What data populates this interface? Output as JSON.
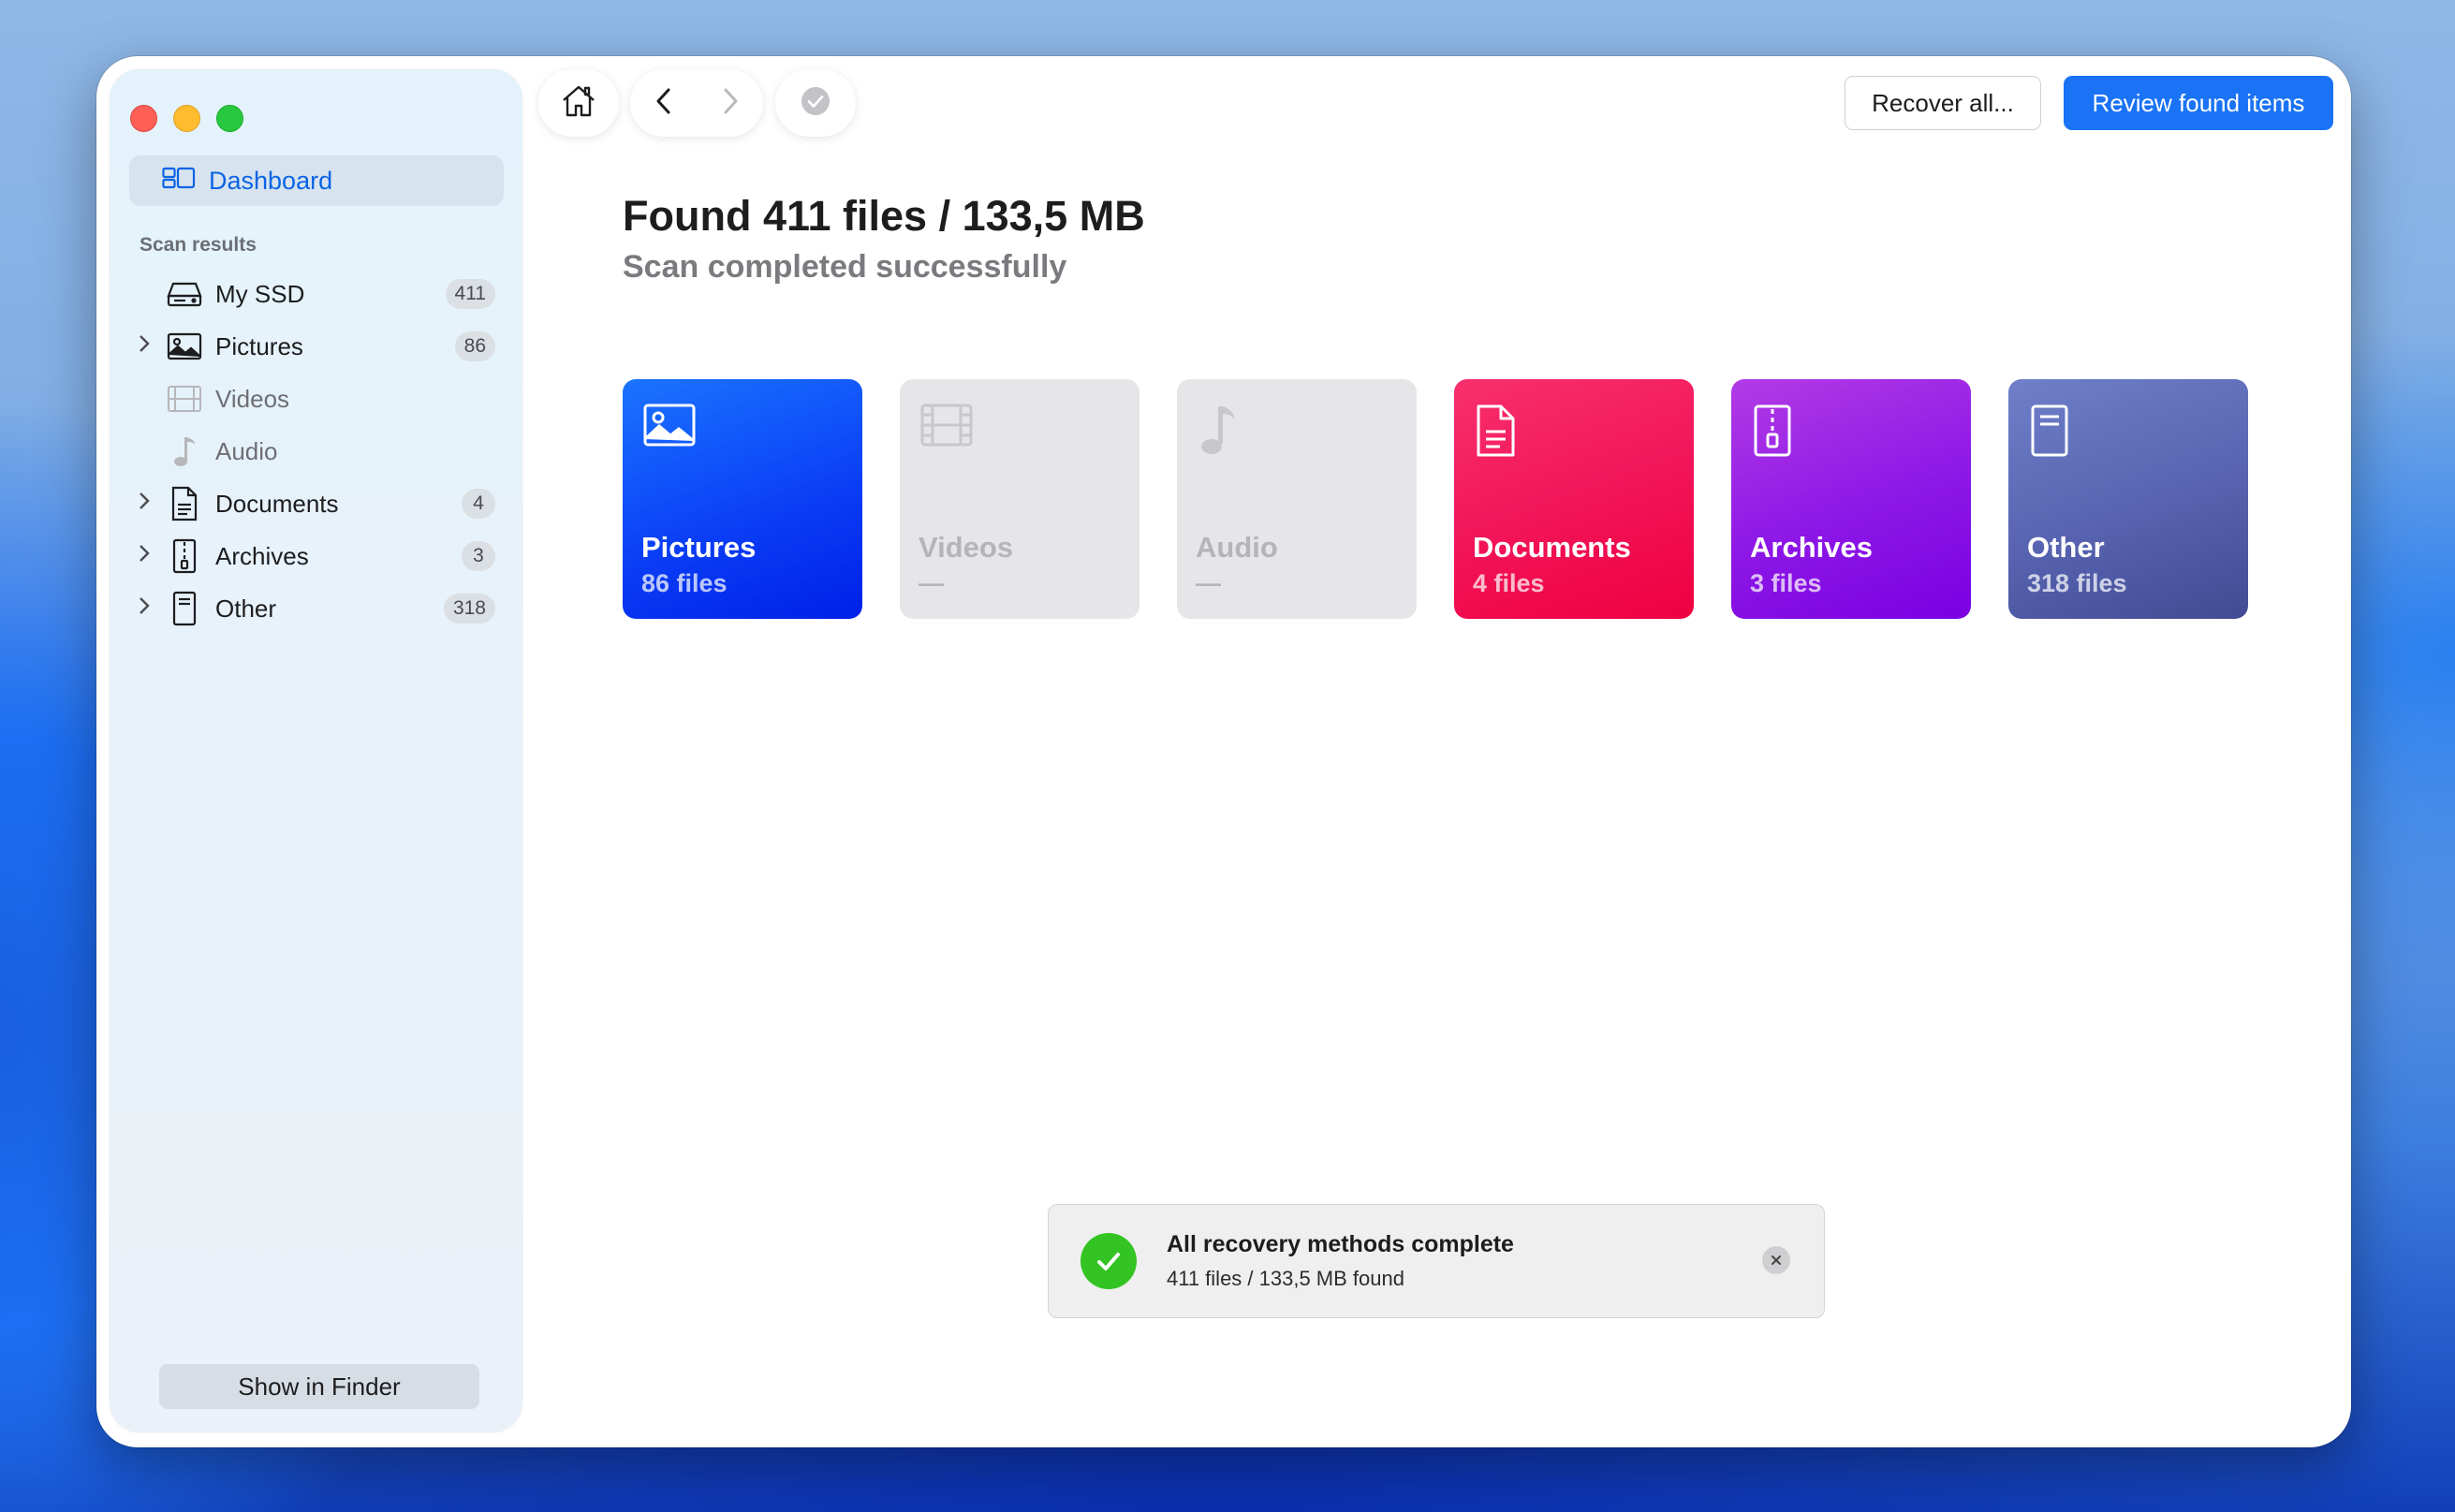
{
  "sidebar": {
    "dashboard_label": "Dashboard",
    "section_title": "Scan results",
    "items": [
      {
        "label": "My SSD",
        "count": "411"
      },
      {
        "label": "Pictures",
        "count": "86"
      },
      {
        "label": "Videos",
        "count": ""
      },
      {
        "label": "Audio",
        "count": ""
      },
      {
        "label": "Documents",
        "count": "4"
      },
      {
        "label": "Archives",
        "count": "3"
      },
      {
        "label": "Other",
        "count": "318"
      }
    ],
    "show_in_finder": "Show in Finder"
  },
  "toolbar": {
    "recover_all": "Recover all...",
    "review_found": "Review found items",
    "home_icon": "house-icon",
    "back_icon": "chevron-left-icon",
    "forward_icon": "chevron-right-icon",
    "check_icon": "checkmark-circle-icon"
  },
  "main": {
    "title": "Found 411 files / 133,5 MB",
    "subtitle": "Scan completed successfully",
    "cards": [
      {
        "name": "Pictures",
        "count": "86 files",
        "color": "#0a3cf5"
      },
      {
        "name": "Videos",
        "count": "—",
        "color": "#e6e6e8"
      },
      {
        "name": "Audio",
        "count": "—",
        "color": "#e6e6e8"
      },
      {
        "name": "Documents",
        "count": "4 files",
        "color": "#f2155a"
      },
      {
        "name": "Archives",
        "count": "3 files",
        "color": "#8d17e6"
      },
      {
        "name": "Other",
        "count": "318 files",
        "color": "#5763b0"
      }
    ]
  },
  "toast": {
    "title": "All recovery methods complete",
    "detail": "411 files / 133,5 MB found"
  },
  "colors": {
    "accent": "#1a73f5",
    "success": "#33c423"
  }
}
